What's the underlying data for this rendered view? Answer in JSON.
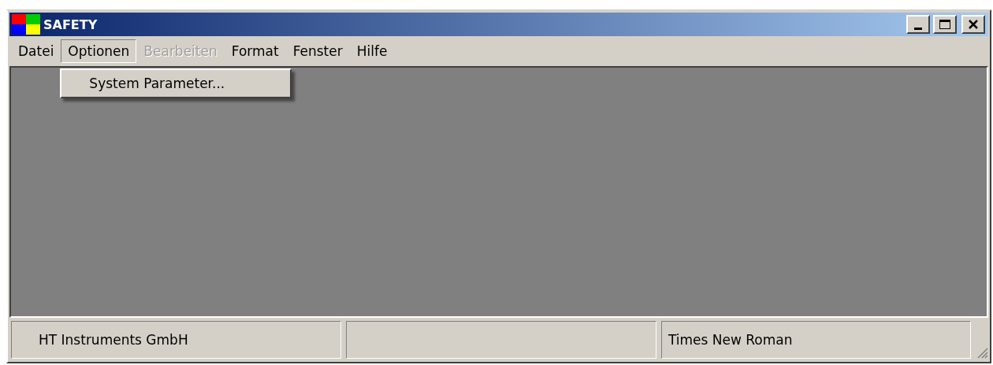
{
  "window": {
    "title": "SAFETY"
  },
  "menu": [
    {
      "label": "Datei",
      "selected": false,
      "disabled": false
    },
    {
      "label": "Optionen",
      "selected": true,
      "disabled": false,
      "dropdown": [
        "System Parameter..."
      ]
    },
    {
      "label": "Bearbeiten",
      "selected": false,
      "disabled": true
    },
    {
      "label": "Format",
      "selected": false,
      "disabled": false
    },
    {
      "label": "Fenster",
      "selected": false,
      "disabled": false
    },
    {
      "label": "Hilfe",
      "selected": false,
      "disabled": false
    }
  ],
  "status_bar": [
    {
      "kind": "text",
      "text": "HT Instruments GmbH"
    },
    {
      "kind": "blank"
    },
    {
      "kind": "text",
      "text": "Times New Roman"
    }
  ]
}
